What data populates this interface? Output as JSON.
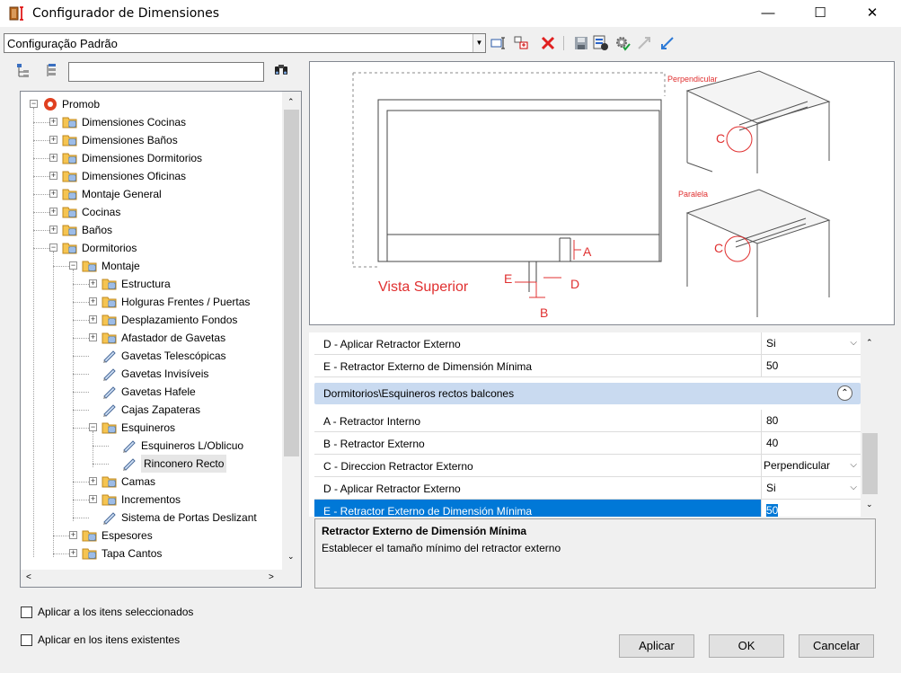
{
  "window": {
    "title": "Configurador de Dimensiones",
    "min_glyph": "—",
    "max_glyph": "☐",
    "close_glyph": "✕"
  },
  "preset": {
    "value": "Configuração Padrão"
  },
  "tree": {
    "items": [
      {
        "label": "Promob"
      },
      {
        "label": "Dimensiones Cocinas"
      },
      {
        "label": "Dimensiones Baños"
      },
      {
        "label": "Dimensiones Dormitorios"
      },
      {
        "label": "Dimensiones Oficinas"
      },
      {
        "label": "Montaje General"
      },
      {
        "label": "Cocinas"
      },
      {
        "label": "Baños"
      },
      {
        "label": "Dormitorios"
      },
      {
        "label": "Montaje"
      },
      {
        "label": "Estructura"
      },
      {
        "label": "Holguras Frentes / Puertas"
      },
      {
        "label": "Desplazamiento Fondos"
      },
      {
        "label": "Afastador de Gavetas"
      },
      {
        "label": "Gavetas Telescópicas"
      },
      {
        "label": "Gavetas Invisíveis"
      },
      {
        "label": "Gavetas Hafele"
      },
      {
        "label": "Cajas Zapateras"
      },
      {
        "label": "Esquineros"
      },
      {
        "label": "Esquineros L/Oblicuo"
      },
      {
        "label": "Rinconero Recto"
      },
      {
        "label": "Camas"
      },
      {
        "label": "Incrementos"
      },
      {
        "label": "Sistema de Portas Deslizant"
      },
      {
        "label": "Espesores"
      },
      {
        "label": "Tapa Cantos"
      }
    ]
  },
  "options": {
    "apply_selected": "Aplicar a los itens seleccionados",
    "apply_existing": "Aplicar en los itens existentes"
  },
  "picture": {
    "vista_superior": "Vista Superior",
    "perpendicular": "Perpendicular",
    "paralela": "Paralela",
    "label_a": "A",
    "label_b": "B",
    "label_c": "C",
    "label_d": "D",
    "label_e": "E"
  },
  "grid": {
    "rows_top": [
      {
        "name": "D - Aplicar Retractor Externo",
        "value": "Si"
      },
      {
        "name": "E - Retractor Externo de Dimensión Mínima",
        "value": "50"
      }
    ],
    "category": "Dormitorios\\Esquineros rectos balcones",
    "rows": [
      {
        "name": "A - Retractor Interno",
        "value": "80"
      },
      {
        "name": "B - Retractor Externo",
        "value": "40"
      },
      {
        "name": "C - Direccion Retractor Externo",
        "value": "Perpendicular"
      },
      {
        "name": "D - Aplicar Retractor Externo",
        "value": "Si"
      },
      {
        "name": "E - Retractor Externo de Dimensión Mínima",
        "value": "50"
      }
    ]
  },
  "description": {
    "title": "Retractor Externo de Dimensión Mínima",
    "text": "Establecer el tamaño mínimo del retractor externo"
  },
  "buttons": {
    "apply": "Aplicar",
    "ok": "OK",
    "cancel": "Cancelar"
  },
  "colors": {
    "selection": "#0078d7",
    "category_band": "#c9daf0",
    "drawing_red": "#e03030"
  }
}
